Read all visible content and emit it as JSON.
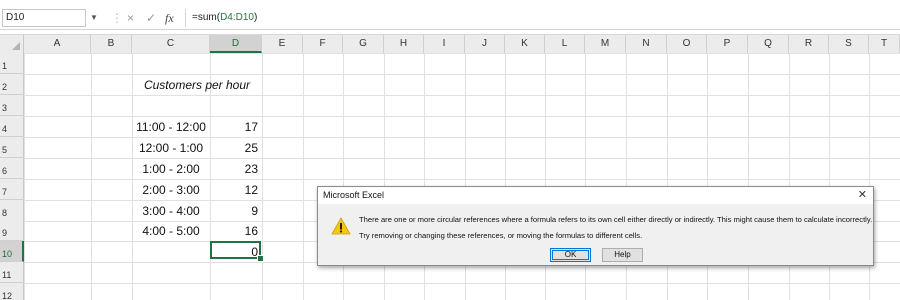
{
  "formula_bar": {
    "name_box": "D10",
    "name_box_dropdown_icon": "chevron-down-icon",
    "cancel_icon": "×",
    "enter_icon": "✓",
    "fx_label": "fx",
    "formula_prefix": "=sum(",
    "formula_ref": "D4:D10",
    "formula_suffix": ")"
  },
  "columns": [
    "A",
    "B",
    "C",
    "D",
    "E",
    "F",
    "G",
    "H",
    "I",
    "J",
    "K",
    "L",
    "M",
    "N",
    "O",
    "P",
    "Q",
    "R",
    "S",
    "T"
  ],
  "active_column": "D",
  "rows": [
    "1",
    "2",
    "3",
    "4",
    "5",
    "6",
    "7",
    "8",
    "9",
    "10",
    "11",
    "12"
  ],
  "active_row": "10",
  "sheet": {
    "c2_title": "Customers per hour",
    "times": [
      "11:00 - 12:00",
      "12:00 - 1:00",
      "1:00 - 2:00",
      "2:00 - 3:00",
      "3:00 - 4:00",
      "4:00 - 5:00"
    ],
    "counts": [
      "17",
      "25",
      "23",
      "12",
      "9",
      "16"
    ],
    "d10_value": "0"
  },
  "dialog": {
    "title": "Microsoft Excel",
    "close": "✕",
    "icon": "warning-icon",
    "message_1": "There are one or more circular references where a formula refers to its own cell either directly or indirectly. This might cause them to calculate incorrectly.",
    "message_2": "Try removing or changing these references, or moving the formulas to different cells.",
    "ok_label": "OK",
    "help_label": "Help"
  },
  "colors": {
    "accent_green": "#217346",
    "warning_yellow": "#f2c811",
    "focus_blue": "#0078d7"
  }
}
